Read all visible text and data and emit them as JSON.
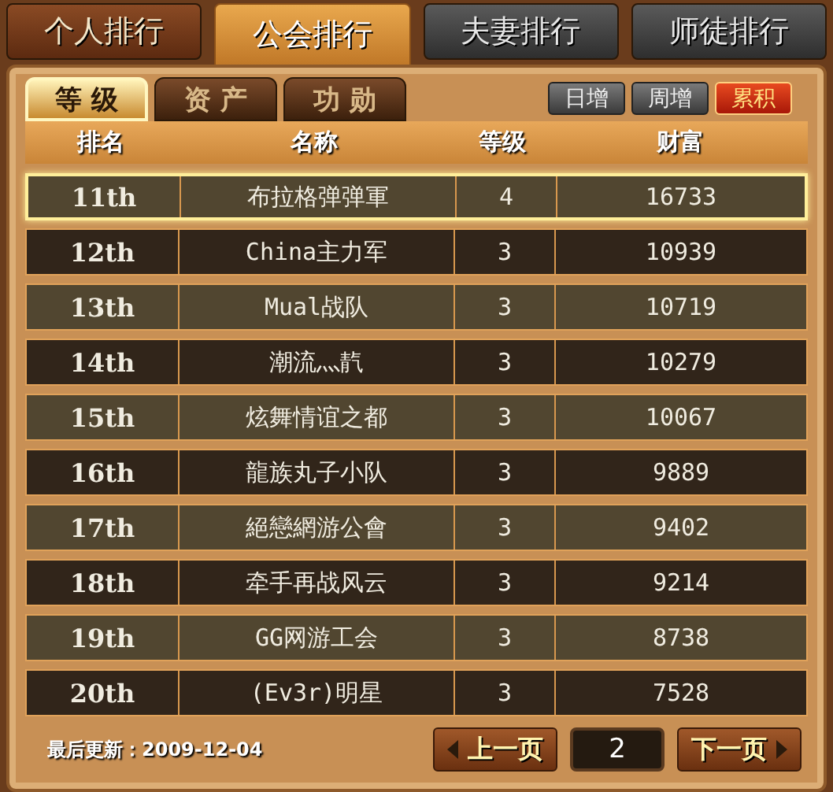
{
  "top_tabs": [
    {
      "label": "个人排行",
      "selected": false,
      "disabled": false
    },
    {
      "label": "公会排行",
      "selected": true,
      "disabled": false
    },
    {
      "label": "夫妻排行",
      "selected": false,
      "disabled": true
    },
    {
      "label": "师徒排行",
      "selected": false,
      "disabled": true
    }
  ],
  "sub_tabs": [
    {
      "label": "等 级",
      "selected": true
    },
    {
      "label": "资 产",
      "selected": false
    },
    {
      "label": "功 勋",
      "selected": false
    }
  ],
  "period_buttons": [
    {
      "label": "日增",
      "selected": false
    },
    {
      "label": "周增",
      "selected": false
    },
    {
      "label": "累积",
      "selected": true
    }
  ],
  "table": {
    "columns": [
      "排名",
      "名称",
      "等级",
      "财富"
    ],
    "rows": [
      {
        "cells": [
          "11th",
          "布拉格弹弹軍",
          "4",
          "16733"
        ],
        "selected": true
      },
      {
        "cells": [
          "12th",
          "China主力军",
          "3",
          "10939"
        ],
        "selected": false
      },
      {
        "cells": [
          "13th",
          "Mual战队",
          "3",
          "10719"
        ],
        "selected": false
      },
      {
        "cells": [
          "14th",
          "潮流灬靔",
          "3",
          "10279"
        ],
        "selected": false
      },
      {
        "cells": [
          "15th",
          "炫舞情谊之都",
          "3",
          "10067"
        ],
        "selected": false
      },
      {
        "cells": [
          "16th",
          "龍族丸子小队",
          "3",
          "9889"
        ],
        "selected": false
      },
      {
        "cells": [
          "17th",
          "絕戀網游公會",
          "3",
          "9402"
        ],
        "selected": false
      },
      {
        "cells": [
          "18th",
          "牵手再战风云",
          "3",
          "9214"
        ],
        "selected": false
      },
      {
        "cells": [
          "19th",
          "GG网游工会",
          "3",
          "8738"
        ],
        "selected": false
      },
      {
        "cells": [
          "20th",
          "(Ev3r)明星",
          "3",
          "7528"
        ],
        "selected": false
      }
    ]
  },
  "footer": {
    "last_updated": "最后更新：2009-12-04",
    "prev_button": "上一页",
    "page": "2",
    "next_button": "下一页"
  }
}
